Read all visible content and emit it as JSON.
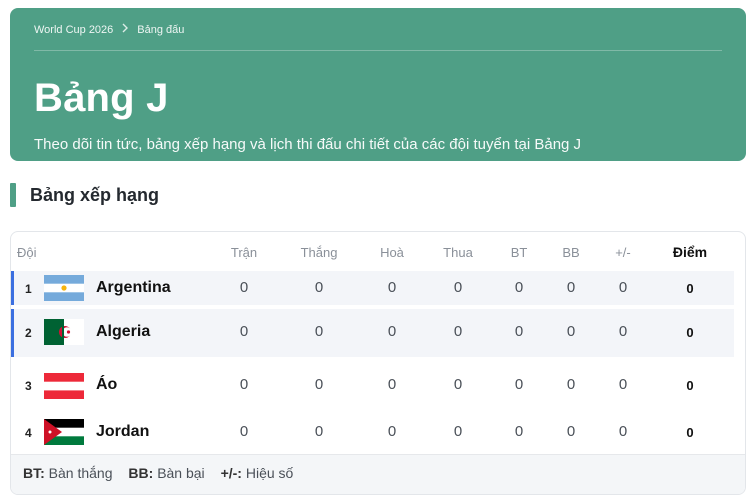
{
  "breadcrumb": {
    "root": "World Cup 2026",
    "current": "Bảng đấu"
  },
  "hero": {
    "title": "Bảng J",
    "subtitle": "Theo dõi tin tức, bảng xếp hạng và lịch thi đấu chi tiết của các đội tuyển tại Bảng J"
  },
  "section": {
    "title": "Bảng xếp hạng"
  },
  "table": {
    "headers": {
      "team": "Đội",
      "played": "Trận",
      "won": "Thắng",
      "drawn": "Hoà",
      "lost": "Thua",
      "gf": "BT",
      "ga": "BB",
      "gd": "+/-",
      "points": "Điểm"
    },
    "rows": [
      {
        "rank": "1",
        "team": "Argentina",
        "flag": "argentina-flag-icon",
        "played": "0",
        "won": "0",
        "drawn": "0",
        "lost": "0",
        "gf": "0",
        "ga": "0",
        "gd": "0",
        "points": "0",
        "highlight": true
      },
      {
        "rank": "2",
        "team": "Algeria",
        "flag": "algeria-flag-icon",
        "played": "0",
        "won": "0",
        "drawn": "0",
        "lost": "0",
        "gf": "0",
        "ga": "0",
        "gd": "0",
        "points": "0",
        "highlight": true
      },
      {
        "rank": "3",
        "team": "Áo",
        "flag": "austria-flag-icon",
        "played": "0",
        "won": "0",
        "drawn": "0",
        "lost": "0",
        "gf": "0",
        "ga": "0",
        "gd": "0",
        "points": "0",
        "highlight": false
      },
      {
        "rank": "4",
        "team": "Jordan",
        "flag": "jordan-flag-icon",
        "played": "0",
        "won": "0",
        "drawn": "0",
        "lost": "0",
        "gf": "0",
        "ga": "0",
        "gd": "0",
        "points": "0",
        "highlight": false
      }
    ]
  },
  "legend": {
    "gf_key": "BT:",
    "gf_text": "Bàn thắng",
    "ga_key": "BB:",
    "ga_text": "Bàn bại",
    "gd_key": "+/-:",
    "gd_text": "Hiệu số"
  },
  "colors": {
    "accent": "#4f9f86",
    "highlight_bar": "#3b6fe0"
  }
}
